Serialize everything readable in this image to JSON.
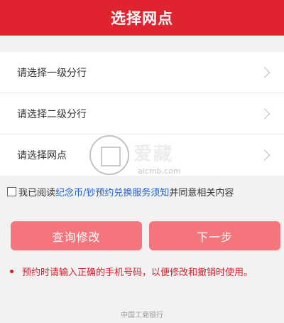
{
  "header": {
    "title": "选择网点"
  },
  "select_rows": [
    {
      "label": "请选择一级分行"
    },
    {
      "label": "请选择二级分行"
    },
    {
      "label": "请选择网点"
    }
  ],
  "watermark": {
    "mark": "爱藏",
    "url": "aicmb.com"
  },
  "agreement": {
    "prefix": "我已阅读",
    "link": "纪念币/钞预约兑换服务须知",
    "suffix": "并同意相关内容",
    "checked": false
  },
  "buttons": {
    "query": "查询修改",
    "next": "下一步"
  },
  "notice": "预约时请输入正确的手机号码，以便修改和撤销时使用。",
  "footer": "中国工商银行",
  "colors": {
    "brand_red": "#e0242f",
    "button_pink": "#f5757c",
    "link_blue": "#1f5fcc",
    "notice_red": "#d21f2a"
  }
}
